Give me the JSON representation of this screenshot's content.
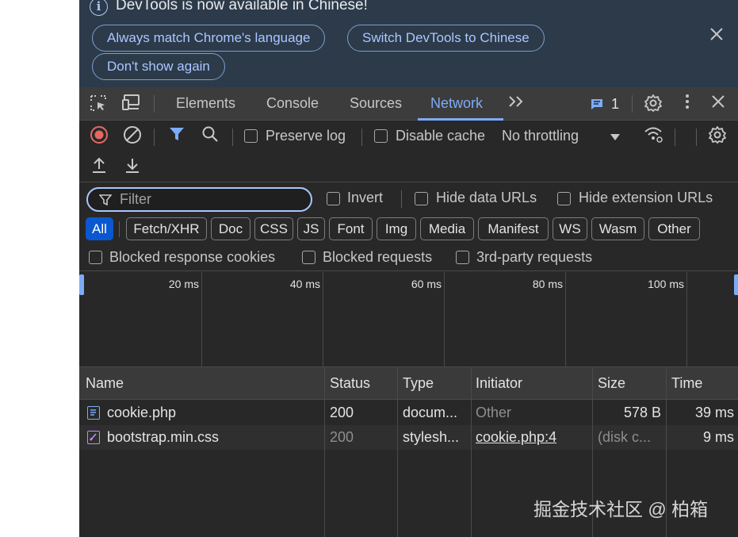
{
  "infobar": {
    "title": "DevTools is now available in Chinese!",
    "info_icon": "i",
    "always_match_label": "Always match Chrome's language",
    "switch_label": "Switch DevTools to Chinese",
    "dont_show_label": "Don't show again"
  },
  "tabs": [
    {
      "label": "Elements"
    },
    {
      "label": "Console"
    },
    {
      "label": "Sources"
    },
    {
      "label": "Network",
      "active": true
    }
  ],
  "issues_count": "1",
  "toolbar": {
    "preserve_log": "Preserve log",
    "disable_cache": "Disable cache",
    "throttling": "No throttling"
  },
  "filter": {
    "placeholder": "Filter",
    "invert": "Invert",
    "hide_data_urls": "Hide data URLs",
    "hide_extension_urls": "Hide extension URLs",
    "types": [
      "All",
      "Fetch/XHR",
      "Doc",
      "CSS",
      "JS",
      "Font",
      "Img",
      "Media",
      "Manifest",
      "WS",
      "Wasm",
      "Other"
    ],
    "blocked_response_cookies": "Blocked response cookies",
    "blocked_requests": "Blocked requests",
    "third_party": "3rd-party requests"
  },
  "timeline": {
    "ticks": [
      "20 ms",
      "40 ms",
      "60 ms",
      "80 ms",
      "100 ms"
    ]
  },
  "table": {
    "columns": [
      "Name",
      "Status",
      "Type",
      "Initiator",
      "Size",
      "Time"
    ],
    "rows": [
      {
        "name": "cookie.php",
        "status": "200",
        "type": "docum...",
        "initiator": "Other",
        "size": "578 B",
        "time": "39 ms"
      },
      {
        "name": "bootstrap.min.css",
        "status": "200",
        "type": "stylesh...",
        "initiator": "cookie.php:4",
        "size": "(disk c...",
        "time": "9 ms"
      }
    ]
  },
  "watermark": "掘金技术社区 @ 柏箱",
  "colors": {
    "panel_bg": "#282828",
    "accent": "#7cacf8",
    "record_red": "#e46962",
    "filter_blue": "#7cacf8"
  },
  "icons": [
    "info-icon",
    "close-icon",
    "inspect-element-icon",
    "device-toolbar-icon",
    "more-tabs-icon",
    "issues-icon",
    "settings-icon",
    "kebab-menu-icon",
    "record-icon",
    "clear-icon",
    "filter-icon",
    "search-icon",
    "wifi-conditions-icon",
    "upload-icon",
    "download-icon",
    "document-file-icon",
    "stylesheet-file-icon"
  ]
}
